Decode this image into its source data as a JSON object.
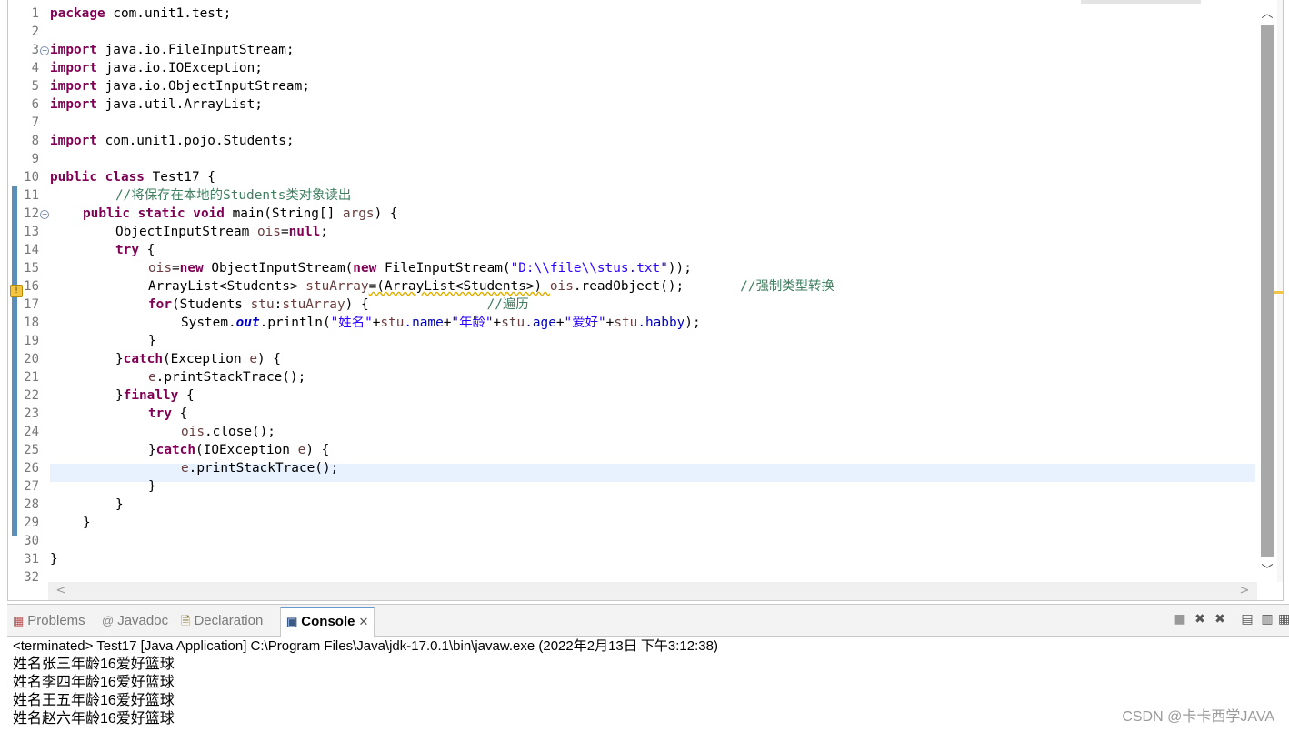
{
  "editor": {
    "line_numbers": [
      "1",
      "2",
      "3",
      "4",
      "5",
      "6",
      "7",
      "8",
      "9",
      "10",
      "11",
      "12",
      "13",
      "14",
      "15",
      "16",
      "17",
      "18",
      "19",
      "20",
      "21",
      "22",
      "23",
      "24",
      "25",
      "26",
      "27",
      "28",
      "29",
      "30",
      "31",
      "32"
    ],
    "code": {
      "l1": {
        "kw": "package",
        "rest": " com.unit1.test;"
      },
      "l3": {
        "kw": "import",
        "rest": " java.io.FileInputStream;"
      },
      "l4": {
        "kw": "import",
        "rest": " java.io.IOException;"
      },
      "l5": {
        "kw": "import",
        "rest": " java.io.ObjectInputStream;"
      },
      "l6": {
        "kw": "import",
        "rest": " java.util.ArrayList;"
      },
      "l8": {
        "kw": "import",
        "rest": " com.unit1.pojo.Students;"
      },
      "l10": {
        "kw": "public class",
        "rest": " Test17 {"
      },
      "l11": {
        "comment": "//将保存在本地的Students类对象读出"
      },
      "l12": {
        "kw": "public static void",
        "rest": " main(String[] ",
        "param": "args",
        "end": ") {"
      },
      "l13": {
        "type": "ObjectInputStream ",
        "var": "ois",
        "eq": "=",
        "kw": "null",
        "end": ";"
      },
      "l14": {
        "kw": "try",
        "end": " {"
      },
      "l15": {
        "var": "ois",
        "eq": "=",
        "kw": "new",
        "mid": " ObjectInputStream(",
        "kw2": "new",
        "mid2": " FileInputStream(",
        "str": "\"D:\\\\file\\\\stus.txt\"",
        "end": "));"
      },
      "l16": {
        "type": "ArrayList<Students> ",
        "var": "stuArray",
        "mid": "=(ArrayList<Students>) ",
        "var2": "ois",
        "end": ".readObject();",
        "comment": "//强制类型转换"
      },
      "l17": {
        "kw": "for",
        "mid": "(Students ",
        "var": "stu",
        "colon": ":",
        "var2": "stuArray",
        "end": ") {",
        "comment": "//遍历"
      },
      "l18": {
        "pre": "System.",
        "sf": "out",
        "mid": ".println(",
        "s1": "\"姓名\"",
        "p1": "+",
        "v1": "stu",
        "f1": ".name",
        "p2": "+",
        "s2": "\"年龄\"",
        "p3": "+",
        "v2": "stu",
        "f2": ".age",
        "p4": "+",
        "s3": "\"爱好\"",
        "p5": "+",
        "v3": "stu",
        "f3": ".habby",
        "end": ");"
      },
      "l19": {
        "end": "}"
      },
      "l20": {
        "pre": "}",
        "kw": "catch",
        "mid": "(Exception ",
        "param": "e",
        "end": ") {"
      },
      "l21": {
        "var": "e",
        "end": ".printStackTrace();"
      },
      "l22": {
        "pre": "}",
        "kw": "finally",
        "end": " {"
      },
      "l23": {
        "kw": "try",
        "end": " {"
      },
      "l24": {
        "var": "ois",
        "end": ".close();"
      },
      "l25": {
        "pre": "}",
        "kw": "catch",
        "mid": "(IOException ",
        "param": "e",
        "end": ") {"
      },
      "l26": {
        "var": "e",
        "end": ".printStackTrace();"
      },
      "l27": {
        "end": "}"
      },
      "l28": {
        "end": "}"
      },
      "l29": {
        "end": "}"
      },
      "l31": {
        "end": "}"
      }
    }
  },
  "views": {
    "tabs": [
      {
        "label": "Problems",
        "icon": "problems-icon"
      },
      {
        "label": "Javadoc",
        "icon": "javadoc-icon"
      },
      {
        "label": "Declaration",
        "icon": "declaration-icon"
      },
      {
        "label": "Console",
        "icon": "console-icon",
        "active": true
      }
    ]
  },
  "console": {
    "launch_info": "<terminated> Test17 [Java Application] C:\\Program Files\\Java\\jdk-17.0.1\\bin\\javaw.exe  (2022年2月13日 下午3:12:38)",
    "output": [
      "姓名张三年龄16爱好篮球",
      "姓名李四年龄16爱好篮球",
      "姓名王五年龄16爱好篮球",
      "姓名赵六年龄16爱好篮球"
    ]
  },
  "watermark": "CSDN @卡卡西学JAVA"
}
